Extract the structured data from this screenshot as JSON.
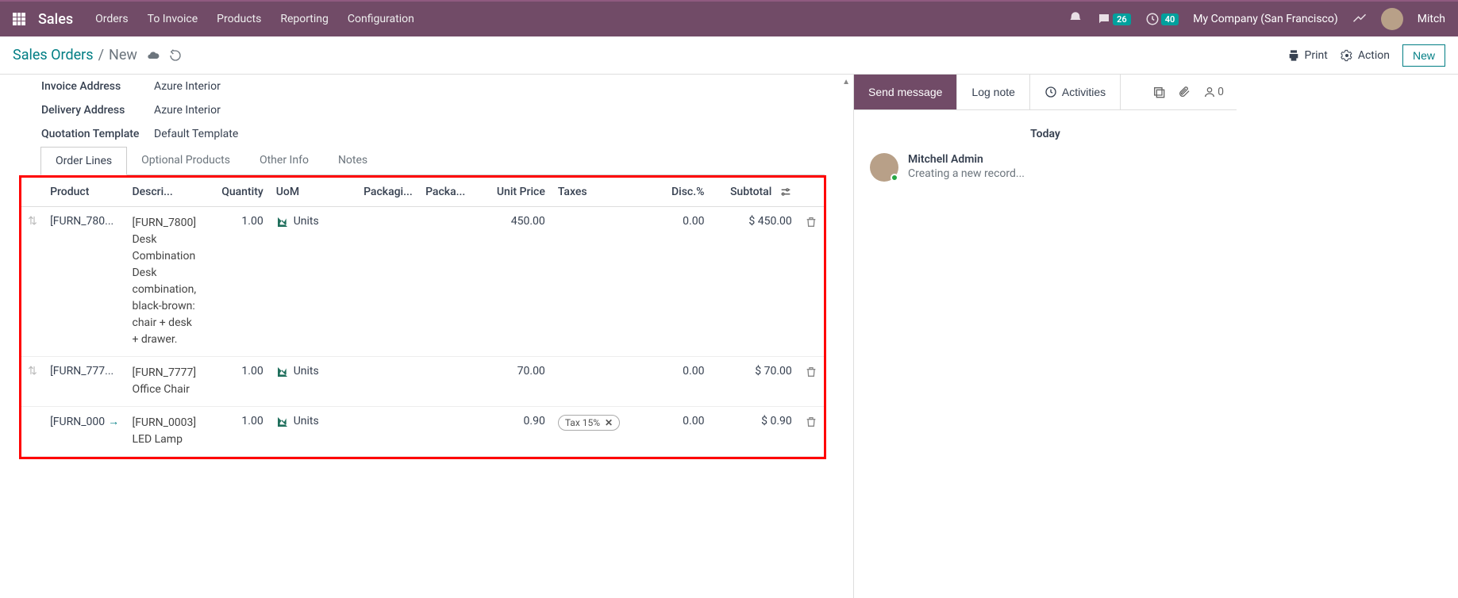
{
  "topbar": {
    "app": "Sales",
    "menu": [
      "Orders",
      "To Invoice",
      "Products",
      "Reporting",
      "Configuration"
    ],
    "messages_badge": "26",
    "activities_badge": "40",
    "company": "My Company (San Francisco)",
    "user_short": "Mitch"
  },
  "header": {
    "breadcrumb_root": "Sales Orders",
    "breadcrumb_current": "New",
    "print": "Print",
    "action": "Action",
    "new": "New"
  },
  "form": {
    "invoice_address_label": "Invoice Address",
    "invoice_address": "Azure Interior",
    "delivery_address_label": "Delivery Address",
    "delivery_address": "Azure Interior",
    "quotation_template_label": "Quotation Template",
    "quotation_template": "Default Template"
  },
  "tabs": {
    "order_lines": "Order Lines",
    "optional_products": "Optional Products",
    "other_info": "Other Info",
    "notes": "Notes"
  },
  "grid": {
    "headers": {
      "product": "Product",
      "description": "Descri...",
      "quantity": "Quantity",
      "uom": "UoM",
      "packaging": "Packagi...",
      "packaging_qty": "Packa...",
      "unit_price": "Unit Price",
      "taxes": "Taxes",
      "disc": "Disc.%",
      "subtotal": "Subtotal"
    },
    "rows": [
      {
        "product": "[FURN_780...",
        "description": "[FURN_7800] Desk Combination\nDesk combination, black-brown: chair + desk + drawer.",
        "qty": "1.00",
        "uom": "Units",
        "unit_price": "450.00",
        "tax": "",
        "disc": "0.00",
        "subtotal": "$ 450.00",
        "editing": false
      },
      {
        "product": "[FURN_777...",
        "description": "[FURN_7777] Office Chair",
        "qty": "1.00",
        "uom": "Units",
        "unit_price": "70.00",
        "tax": "",
        "disc": "0.00",
        "subtotal": "$ 70.00",
        "editing": false
      },
      {
        "product": "[FURN_000",
        "description": "[FURN_0003] LED Lamp",
        "qty": "1.00",
        "uom": "Units",
        "unit_price": "0.90",
        "tax": "Tax 15%",
        "disc": "0.00",
        "subtotal": "$ 0.90",
        "editing": true
      }
    ]
  },
  "chatter": {
    "send": "Send message",
    "lognote": "Log note",
    "activities": "Activities",
    "followers": "0",
    "today": "Today",
    "author": "Mitchell Admin",
    "body": "Creating a new record..."
  }
}
